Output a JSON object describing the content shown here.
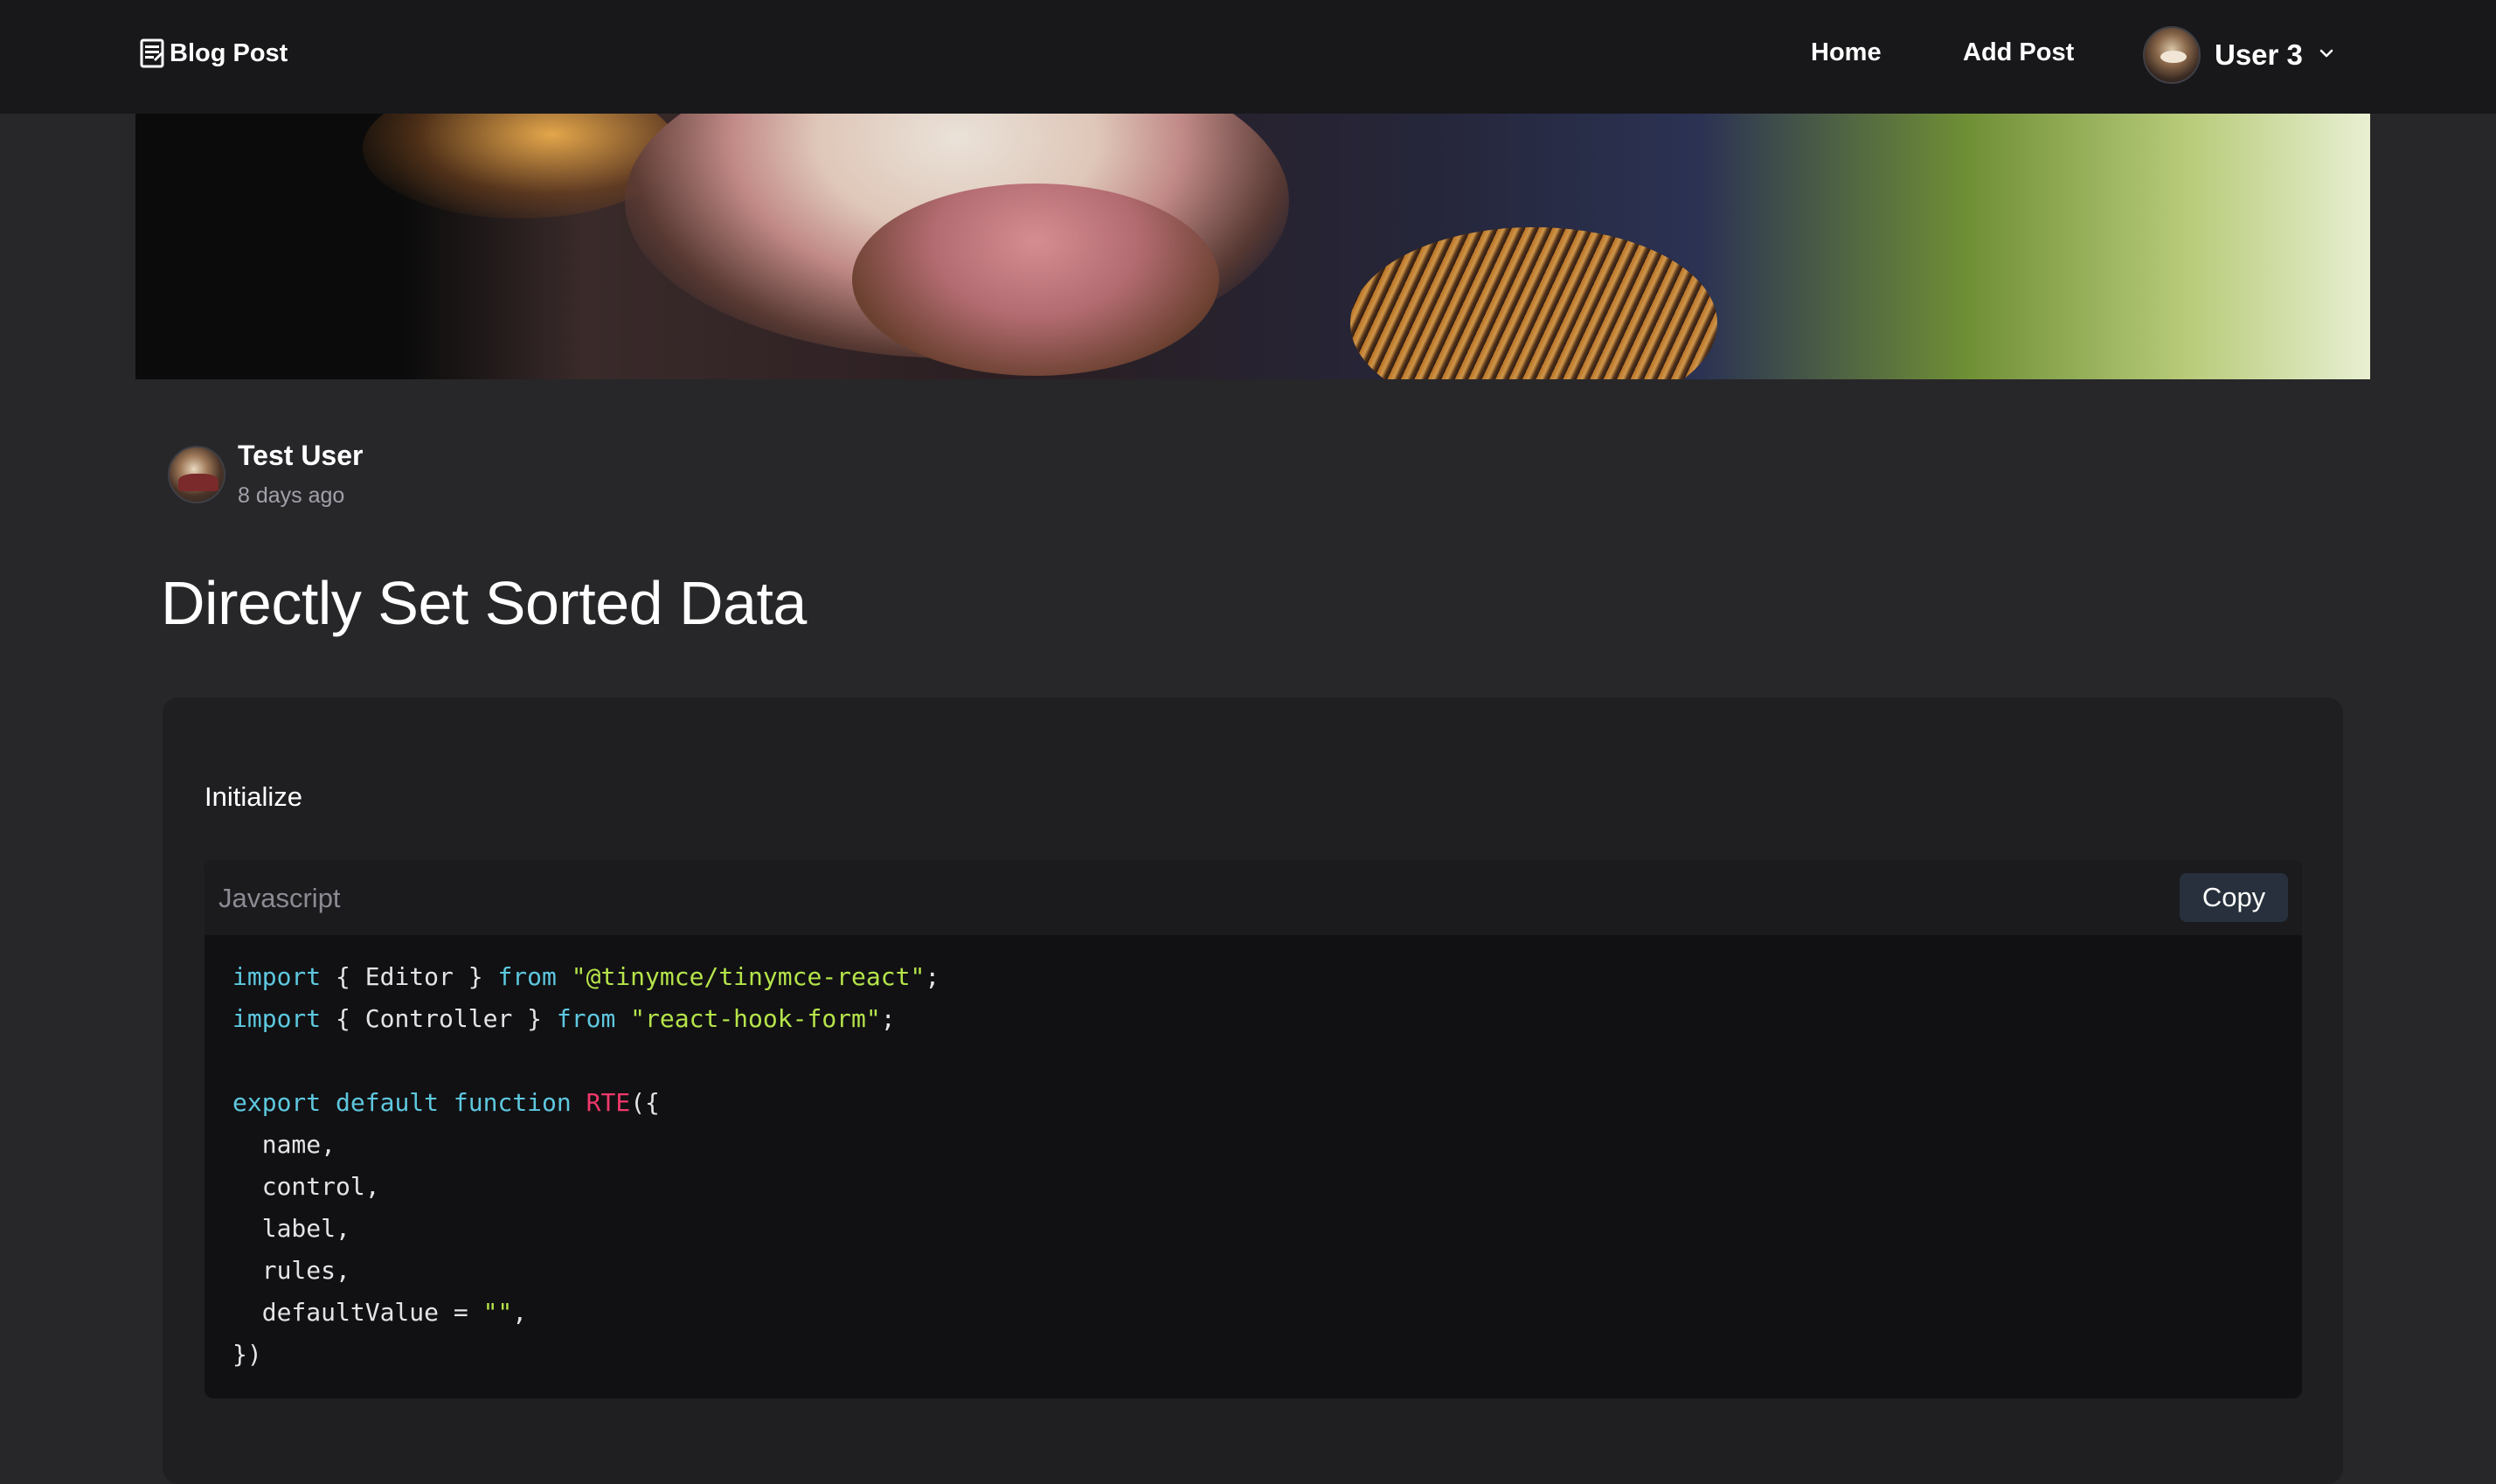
{
  "navbar": {
    "brand": "Blog Post",
    "links": [
      {
        "label": "Home"
      },
      {
        "label": "Add Post"
      }
    ],
    "user": {
      "name": "User 3"
    }
  },
  "post": {
    "author": {
      "name": "Test User",
      "time": "8 days ago"
    },
    "title": "Directly Set Sorted Data",
    "section_heading": "Initialize",
    "code": {
      "language": "Javascript",
      "copy_label": "Copy",
      "lines": [
        [
          {
            "t": "import",
            "c": "kw"
          },
          {
            "t": " { Editor } ",
            "c": ""
          },
          {
            "t": "from",
            "c": "kw"
          },
          {
            "t": " ",
            "c": ""
          },
          {
            "t": "\"@tinymce/tinymce-react\"",
            "c": "str"
          },
          {
            "t": ";",
            "c": ""
          }
        ],
        [
          {
            "t": "import",
            "c": "kw"
          },
          {
            "t": " { Controller } ",
            "c": ""
          },
          {
            "t": "from",
            "c": "kw"
          },
          {
            "t": " ",
            "c": ""
          },
          {
            "t": "\"react-hook-form\"",
            "c": "str"
          },
          {
            "t": ";",
            "c": ""
          }
        ],
        [],
        [
          {
            "t": "export",
            "c": "kw"
          },
          {
            "t": " ",
            "c": ""
          },
          {
            "t": "default",
            "c": "kw"
          },
          {
            "t": " ",
            "c": ""
          },
          {
            "t": "function",
            "c": "kw"
          },
          {
            "t": " ",
            "c": ""
          },
          {
            "t": "RTE",
            "c": "fn"
          },
          {
            "t": "({",
            "c": ""
          }
        ],
        [
          {
            "t": "  name,",
            "c": ""
          }
        ],
        [
          {
            "t": "  control,",
            "c": ""
          }
        ],
        [
          {
            "t": "  label,",
            "c": ""
          }
        ],
        [
          {
            "t": "  rules,",
            "c": ""
          }
        ],
        [
          {
            "t": "  defaultValue = ",
            "c": ""
          },
          {
            "t": "\"\"",
            "c": "str"
          },
          {
            "t": ",",
            "c": ""
          }
        ],
        [
          {
            "t": "})",
            "c": ""
          }
        ]
      ]
    }
  },
  "colors": {
    "background": "#27272a",
    "navbar": "#18181b",
    "card": "#1f1f22",
    "code_bg": "#111113",
    "keyword": "#5ec8e0",
    "string": "#b5e44a",
    "function_name": "#f0386b"
  },
  "icons": {
    "brand": "document-icon",
    "dropdown": "chevron-down-icon"
  }
}
